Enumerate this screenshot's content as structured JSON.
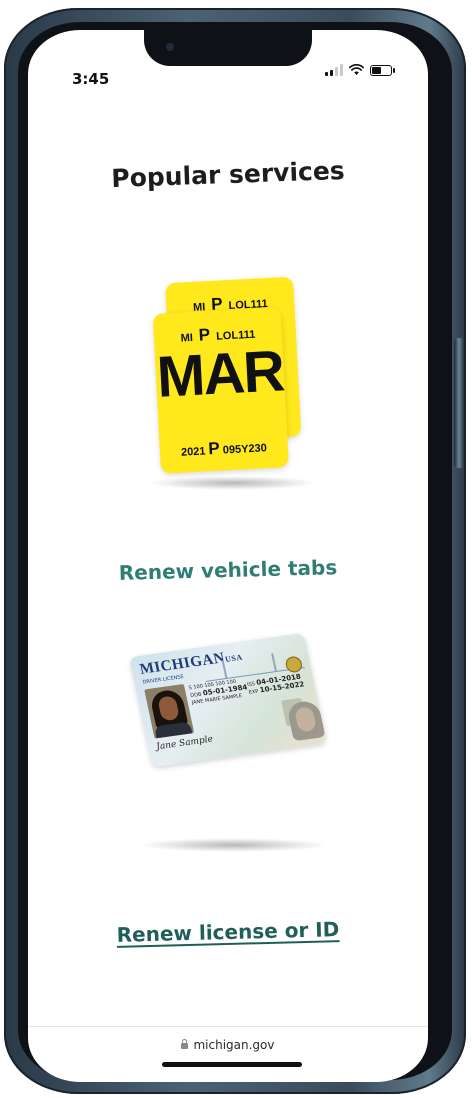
{
  "status_bar": {
    "time": "3:45",
    "icons": [
      "signal-icon",
      "wifi-icon",
      "battery-icon"
    ]
  },
  "page": {
    "title": "Popular services"
  },
  "services": [
    {
      "label": "Renew vehicle tabs",
      "image": {
        "back": {
          "state": "MI",
          "class": "P",
          "plate": "LOL111"
        },
        "front": {
          "state": "MI",
          "class": "P",
          "plate": "LOL111",
          "month": "MAR",
          "year": "2021",
          "serial_class": "P",
          "serial": "095Y230"
        }
      }
    },
    {
      "label": "Renew license or ID",
      "image": {
        "state": "MICHIGAN",
        "state_suffix": "USA",
        "card_type": "DRIVER LICENSE",
        "dl_number": "S 100 100 100 100",
        "dob": "05-01-1984",
        "name": "JANE MARIE SAMPLE",
        "iss": "04-01-2018",
        "exp": "10-15-2022",
        "signature": "Jane Sample"
      }
    }
  ],
  "browser": {
    "url": "michigan.gov"
  },
  "colors": {
    "link": "#2f7d74",
    "sticker": "#ffe81c",
    "phone_frame": "#3a4c5c"
  }
}
